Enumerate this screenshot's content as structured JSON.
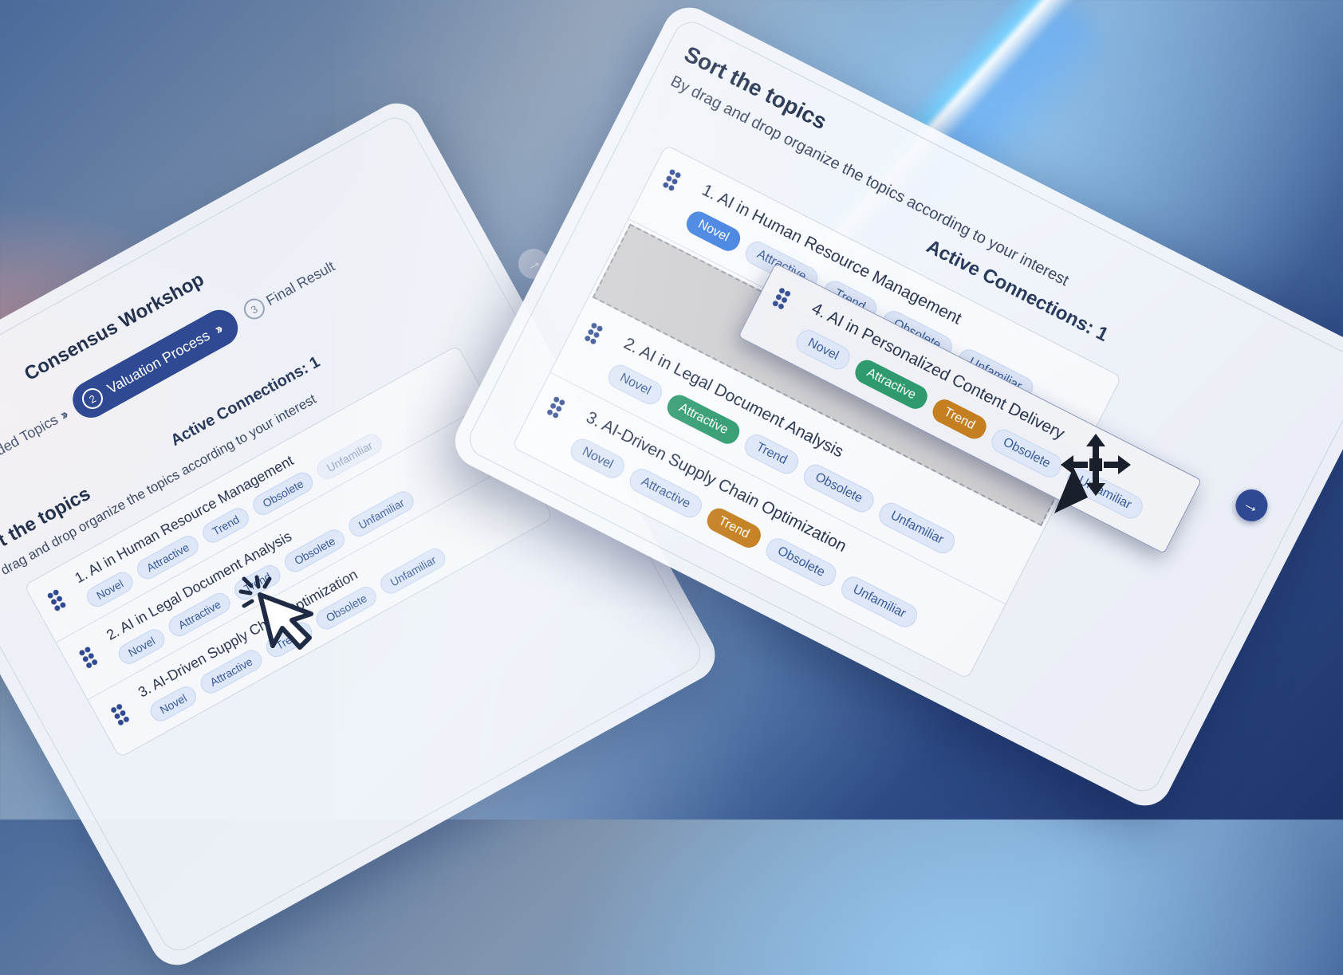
{
  "workshop": {
    "title": "Consensus Workshop",
    "steps": [
      {
        "label": "Recommended Topics",
        "state": "done"
      },
      {
        "number": "2",
        "label": "Valuation Process",
        "state": "active"
      },
      {
        "number": "3",
        "label": "Final Result",
        "state": "pending"
      }
    ]
  },
  "sort": {
    "title": "Sort the topics",
    "subtitle": "By drag and drop organize the topics according to your interest",
    "active_connections": "Active Connections: 1"
  },
  "chip_labels": [
    "Novel",
    "Attractive",
    "Trend",
    "Obsolete",
    "Unfamiliar"
  ],
  "left_list": [
    {
      "title": "1. AI in Human Resource Management"
    },
    {
      "title": "2. AI in Legal Document Analysis"
    },
    {
      "title": "3. AI-Driven Supply Chain Optimization"
    }
  ],
  "right_list": [
    {
      "title": "1. AI in Human Resource Management",
      "selected": "Novel"
    },
    {
      "title": "2. AI in Legal Document Analysis",
      "selected": "Attractive"
    },
    {
      "title": "3. AI-Driven Supply Chain Optimization",
      "selected": "Trend"
    }
  ],
  "dragging_item": {
    "title": "4. AI in Personalized Content Delivery",
    "selected": [
      "Attractive",
      "Trend"
    ]
  },
  "icons": {
    "next": "arrow-right-icon",
    "drag_handle": "grip-dots-icon",
    "cursor": "click-cursor-icon",
    "move": "move-arrows-icon",
    "chevrons": "double-chevron-right-icon"
  },
  "colors": {
    "primary": "#2f4a92",
    "chip_bg": "#dde7f7",
    "novel_selected": "#3f7fe0",
    "attractive_selected": "#2e9a6e",
    "trend_selected": "#c47f20"
  }
}
